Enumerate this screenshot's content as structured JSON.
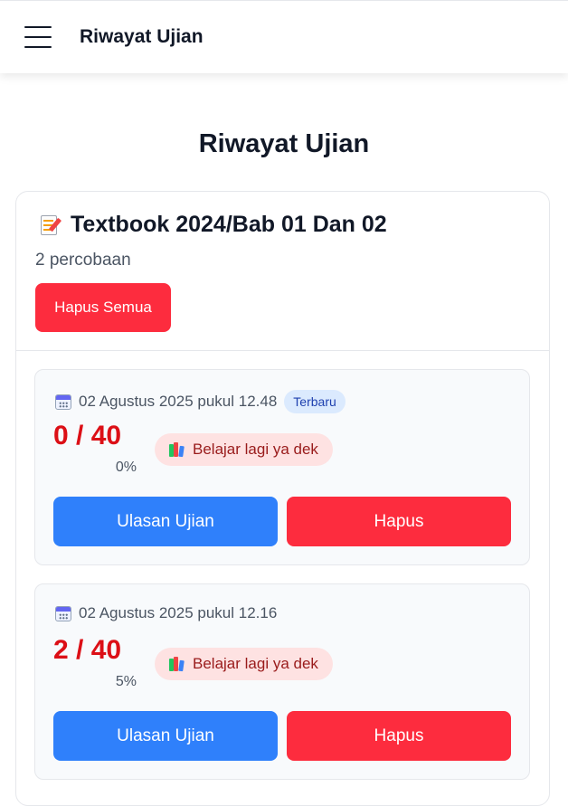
{
  "header": {
    "title": "Riwayat Ujian",
    "menu_icon": "hamburger-icon"
  },
  "page": {
    "title": "Riwayat Ujian"
  },
  "exam": {
    "title": "Textbook 2024/Bab 01 Dan 02",
    "title_icon": "memo-icon",
    "attempts_text": "2 percobaan",
    "clear_all_label": "Hapus Semua",
    "attempts": [
      {
        "date": "02 Agustus 2025 pukul 12.48",
        "badge": "Terbaru",
        "score": "0 / 40",
        "percent": "0%",
        "feedback": "Belajar lagi ya dek",
        "review_label": "Ulasan Ujian",
        "delete_label": "Hapus"
      },
      {
        "date": "02 Agustus 2025 pukul 12.16",
        "score": "2 / 40",
        "percent": "5%",
        "feedback": "Belajar lagi ya dek",
        "review_label": "Ulasan Ujian",
        "delete_label": "Hapus"
      }
    ]
  },
  "colors": {
    "primary_button": "#2f80fb",
    "danger_button": "#fd2c3e",
    "score_text": "#dc0f16",
    "badge_bg": "#dbeafe",
    "feedback_bg": "#fee2e2"
  }
}
